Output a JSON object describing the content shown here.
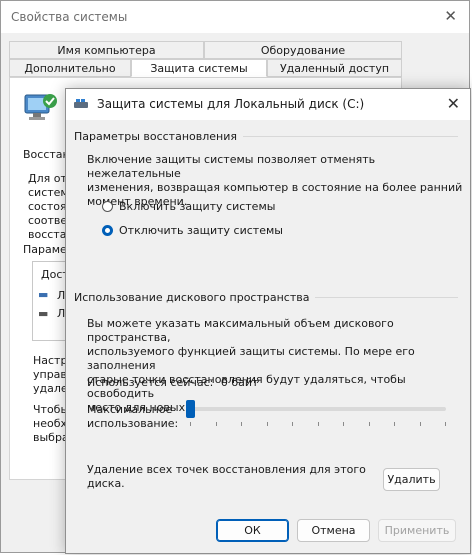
{
  "background_window": {
    "title": "Свойства системы",
    "tabs_row1": [
      "Имя компьютера",
      "Оборудование"
    ],
    "tabs_row2": [
      "Дополнительно",
      "Защита системы",
      "Удаленный доступ"
    ],
    "fragments": {
      "restore": "Восстано",
      "p1": "Для отм",
      "p2": "системы",
      "p3": "состоян",
      "p4": "соответ",
      "p5": "восстан",
      "params": "Парамет",
      "list_header": "Дост",
      "list_item1": "Л",
      "list_item2": "Л",
      "cfg1": "Настро",
      "cfg2": "управл",
      "cfg3": "удален",
      "create1": "Чтобы",
      "create2": "необхо",
      "create3": "выбрав"
    }
  },
  "dialog": {
    "title": "Защита системы для Локальный диск (C:)",
    "restore_section": {
      "heading": "Параметры восстановления",
      "description_lines": [
        "Включение защиты системы позволяет отменять нежелательные",
        "изменения, возвращая компьютер в состояние на более ранний",
        "момент времени."
      ],
      "options": [
        {
          "label": "Включить защиту системы",
          "selected": false
        },
        {
          "label": "Отключить защиту системы",
          "selected": true
        }
      ]
    },
    "disk_section": {
      "heading": "Использование дискового пространства",
      "description_lines": [
        "Вы можете указать максимальный объем дискового пространства,",
        "используемого функцией защиты системы. По мере его заполнения",
        "старые точки восстановления будут удаляться, чтобы освободить",
        "место для новых."
      ],
      "current_usage_label": "Используется сейчас:",
      "current_usage_value": "0 байт",
      "max_usage_label_lines": [
        "Максимальное",
        "использование:"
      ],
      "max_usage_slider_fraction": 0,
      "delete_text_lines": [
        "Удаление всех точек восстановления для этого",
        "диска."
      ],
      "delete_button": "Удалить"
    },
    "buttons": {
      "ok": "ОК",
      "cancel": "Отмена",
      "apply": "Применить"
    }
  },
  "colors": {
    "accent": "#005fb8"
  }
}
